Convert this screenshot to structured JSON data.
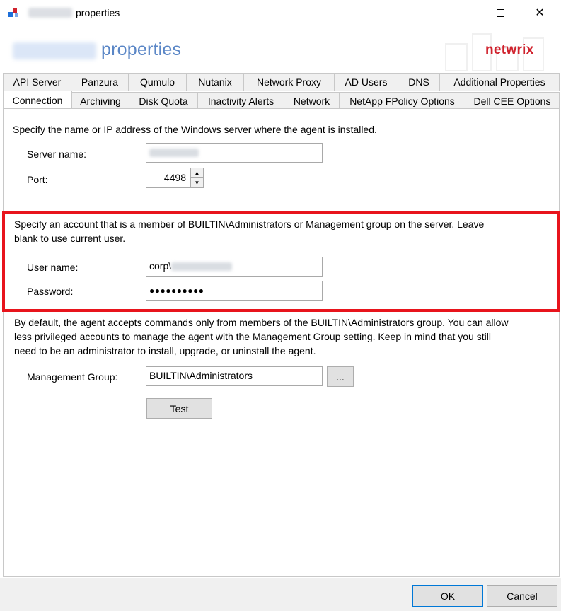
{
  "window": {
    "title": "properties",
    "controls": {
      "minimize": "minimize",
      "maximize": "maximize",
      "close": "✕"
    }
  },
  "header": {
    "title": "properties",
    "brand": "netwrix"
  },
  "tabs": {
    "row1": [
      {
        "label": "API Server"
      },
      {
        "label": "Panzura"
      },
      {
        "label": "Qumulo"
      },
      {
        "label": "Nutanix"
      },
      {
        "label": "Network Proxy"
      },
      {
        "label": "AD Users"
      },
      {
        "label": "DNS"
      },
      {
        "label": "Additional Properties"
      }
    ],
    "row2": [
      {
        "label": "Connection",
        "active": true
      },
      {
        "label": "Archiving"
      },
      {
        "label": "Disk Quota"
      },
      {
        "label": "Inactivity Alerts"
      },
      {
        "label": "Network"
      },
      {
        "label": "NetApp FPolicy Options"
      },
      {
        "label": "Dell CEE Options"
      }
    ]
  },
  "connection": {
    "server_intro": "Specify the name or IP address of the Windows server where the agent is installed.",
    "server_name_label": "Server name:",
    "port_label": "Port:",
    "port_value": "4498",
    "account_intro_line1": "Specify an account that is a member of BUILTIN\\Administrators or Management group on the server. Leave",
    "account_intro_line2": "blank to use current user.",
    "username_label": "User name:",
    "username_prefix": "corp\\",
    "password_label": "Password:",
    "password_mask": "●●●●●●●●●●",
    "mgmt_line1": "By default, the agent accepts commands only from members of the BUILTIN\\Administrators group.  You can allow",
    "mgmt_line2": "less privileged accounts to manage the agent with the Management Group setting.  Keep in mind that you still",
    "mgmt_line3": "need to be an administrator to install, upgrade, or uninstall the agent.",
    "mgmt_group_label": "Management Group:",
    "mgmt_group_value": "BUILTIN\\Administrators",
    "browse_label": "...",
    "test_label": "Test"
  },
  "footer": {
    "ok_label": "OK",
    "cancel_label": "Cancel"
  },
  "colors": {
    "highlight_frame": "#e8141c",
    "header_title": "#5a86c6",
    "brand": "#d0222d"
  }
}
